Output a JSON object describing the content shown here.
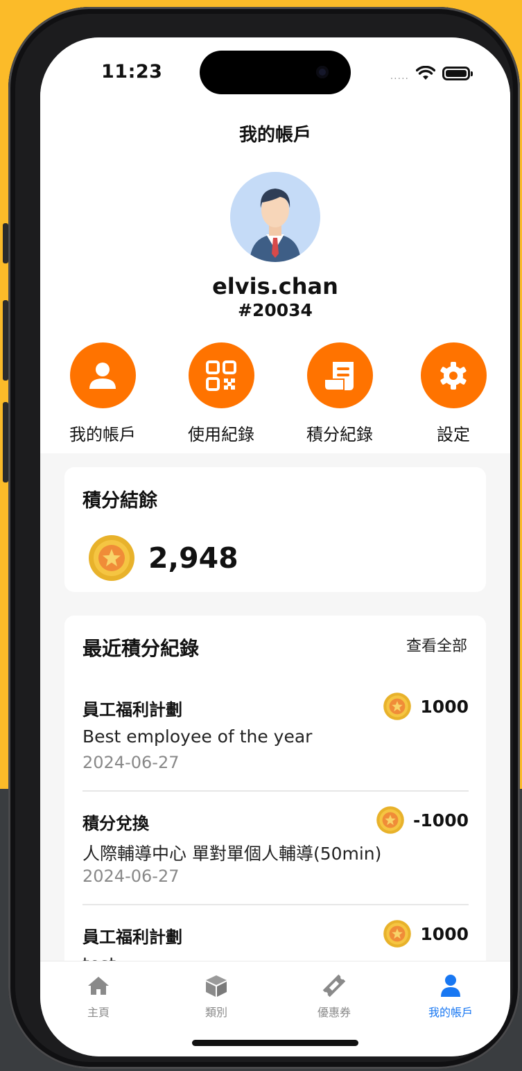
{
  "status_bar": {
    "time": "11:23",
    "signal": "....."
  },
  "header": {
    "title": "我的帳戶"
  },
  "profile": {
    "username": "elvis.chan",
    "user_id": "#20034"
  },
  "actions": [
    {
      "label": "我的帳戶",
      "icon": "user-icon"
    },
    {
      "label": "使用紀錄",
      "icon": "qr-code-icon"
    },
    {
      "label": "積分紀錄",
      "icon": "receipt-icon"
    },
    {
      "label": "設定",
      "icon": "gear-icon"
    }
  ],
  "balance": {
    "title": "積分結餘",
    "value": "2,948",
    "icon": "coin-icon"
  },
  "records": {
    "title": "最近積分紀錄",
    "view_all": "查看全部",
    "items": [
      {
        "name": "員工福利計劃",
        "points": "1000",
        "description": "Best employee of the year",
        "date": "2024-06-27"
      },
      {
        "name": "積分兌換",
        "points": "-1000",
        "description": "人際輔導中心 單對單個人輔導(50min)",
        "date": "2024-06-27"
      },
      {
        "name": "員工福利計劃",
        "points": "1000",
        "description": "test",
        "date": ""
      }
    ]
  },
  "tabbar": [
    {
      "label": "主頁",
      "icon": "home-icon",
      "active": false
    },
    {
      "label": "類別",
      "icon": "box-icon",
      "active": false
    },
    {
      "label": "優惠券",
      "icon": "ticket-icon",
      "active": false
    },
    {
      "label": "我的帳戶",
      "icon": "user-icon",
      "active": true
    }
  ],
  "colors": {
    "accent": "#FF7300",
    "active_tab": "#1877F2",
    "background": "#FBBB29"
  }
}
